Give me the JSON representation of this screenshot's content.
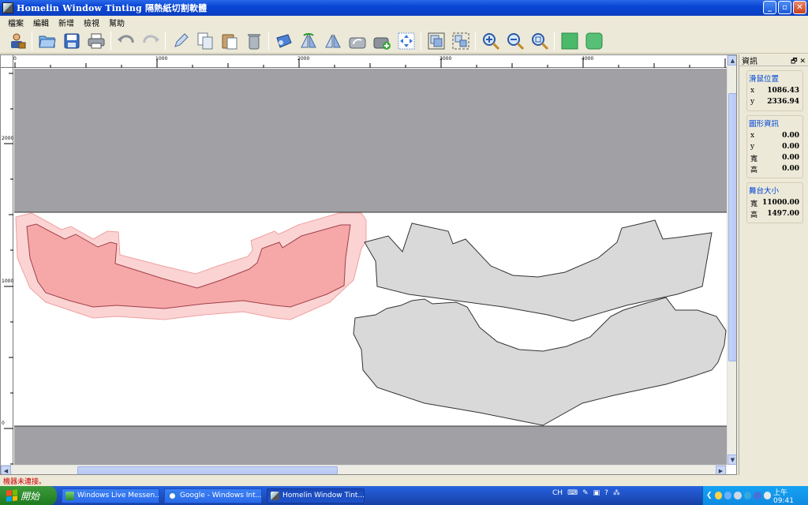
{
  "window": {
    "title": "Homelin Window Tinting 隔熱紙切割軟體",
    "controls": {
      "minimize": "_",
      "maximize": "▫",
      "close": "✕"
    }
  },
  "menu": [
    "檔案",
    "編輯",
    "新增",
    "檢視",
    "幫助"
  ],
  "toolbar": [
    "user-icon",
    "open-folder-icon",
    "save-icon",
    "print-icon",
    "undo-icon",
    "redo-icon",
    "pen-icon",
    "copy-icon",
    "paste-icon",
    "delete-icon",
    "roll-icon",
    "mirror-horizontal-icon",
    "mirror-vertical-icon",
    "rotate-icon",
    "rotate-add-icon",
    "move-icon",
    "group-icon",
    "ungroup-icon",
    "zoom-in-icon",
    "zoom-out-icon",
    "zoom-fit-icon",
    "green-square-icon",
    "green-rounded-icon"
  ],
  "rulers": {
    "horizontal": [
      "0",
      "1000",
      "2000",
      "3000",
      "4000"
    ],
    "vertical": [
      "2000",
      "1000",
      "0"
    ]
  },
  "info_panel": {
    "title": "資訊",
    "pin": "🗗",
    "close": "✕",
    "mouse": {
      "title": "滑鼠位置",
      "x_label": "x",
      "x": "1086.43",
      "y_label": "y",
      "y": "2336.94"
    },
    "shape": {
      "title": "圖形資訊",
      "x_label": "x",
      "x": "0.00",
      "y_label": "y",
      "y": "0.00",
      "w_label": "寬",
      "w": "0.00",
      "h_label": "高",
      "h": "0.00"
    },
    "stage": {
      "title": "舞台大小",
      "w_label": "寬",
      "w": "11000.00",
      "h_label": "高",
      "h": "1497.00"
    }
  },
  "status": "機器未連接。",
  "taskbar": {
    "start": "開始",
    "tasks": [
      "Windows Live Messen...",
      "Google - Windows Int...",
      "Homelin Window Tint..."
    ],
    "lang": "CH",
    "clock": "上午 09:41"
  },
  "colors": {
    "band": "#a1a0a5",
    "selected_fill": "#f6a8a8",
    "selected_outer": "#fbd3d3",
    "shape_fill": "#d9d9d9"
  }
}
